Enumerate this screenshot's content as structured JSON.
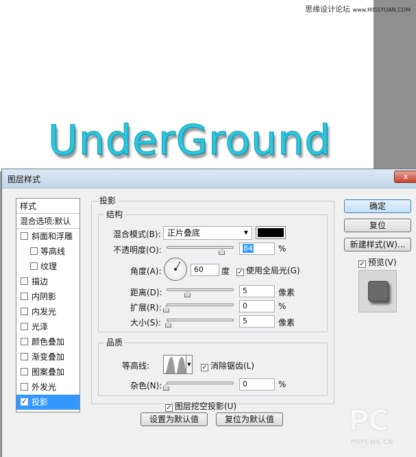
{
  "watermark_top": {
    "site": "思缘设计论坛",
    "url": "www.MISSYUAN.COM"
  },
  "canvas": {
    "headline": "UnderGround",
    "headline_color": "#2cc6dc"
  },
  "dialog": {
    "title": "图层样式",
    "close_label": "x",
    "style_list": {
      "header": "样式",
      "blend_header": "混合选项:默认",
      "items": [
        {
          "label": "斜面和浮雕",
          "checked": false,
          "sub": false,
          "selected": false
        },
        {
          "label": "等高线",
          "checked": false,
          "sub": true,
          "selected": false
        },
        {
          "label": "纹理",
          "checked": false,
          "sub": true,
          "selected": false
        },
        {
          "label": "描边",
          "checked": false,
          "sub": false,
          "selected": false
        },
        {
          "label": "内阴影",
          "checked": false,
          "sub": false,
          "selected": false
        },
        {
          "label": "内发光",
          "checked": false,
          "sub": false,
          "selected": false
        },
        {
          "label": "光泽",
          "checked": false,
          "sub": false,
          "selected": false
        },
        {
          "label": "颜色叠加",
          "checked": false,
          "sub": false,
          "selected": false
        },
        {
          "label": "渐变叠加",
          "checked": false,
          "sub": false,
          "selected": false
        },
        {
          "label": "图案叠加",
          "checked": false,
          "sub": false,
          "selected": false
        },
        {
          "label": "外发光",
          "checked": false,
          "sub": false,
          "selected": false
        },
        {
          "label": "投影",
          "checked": true,
          "sub": false,
          "selected": true
        }
      ]
    },
    "drop_shadow": {
      "section_title": "投影",
      "structure": {
        "title": "结构",
        "blend_mode_label": "混合模式(B):",
        "blend_mode_value": "正片叠底",
        "color": "#000000",
        "opacity_label": "不透明度(O):",
        "opacity_value": "84",
        "opacity_unit": "%",
        "angle_label": "角度(A):",
        "angle_value": "60",
        "angle_unit": "度",
        "global_light_label": "使用全局光(G)",
        "global_light_checked": true,
        "distance_label": "距离(D):",
        "distance_value": "5",
        "distance_unit": "像素",
        "spread_label": "扩展(R):",
        "spread_value": "0",
        "spread_unit": "%",
        "size_label": "大小(S):",
        "size_value": "5",
        "size_unit": "像素"
      },
      "quality": {
        "title": "品质",
        "contour_label": "等高线:",
        "anti_alias_label": "消除锯齿(L)",
        "anti_alias_checked": true,
        "noise_label": "杂色(N):",
        "noise_value": "0",
        "noise_unit": "%"
      },
      "layer_knockout_label": "图层挖空投影(U)",
      "layer_knockout_checked": true,
      "make_default_label": "设置为默认值",
      "reset_default_label": "复位为默认值"
    },
    "buttons": {
      "ok": "确定",
      "reset": "复位",
      "new_style": "新建样式(W)...",
      "preview_label": "预览(V)",
      "preview_checked": true
    }
  },
  "watermark_bottom": {
    "logo": "PC",
    "url": "PHPCMS.CN"
  }
}
